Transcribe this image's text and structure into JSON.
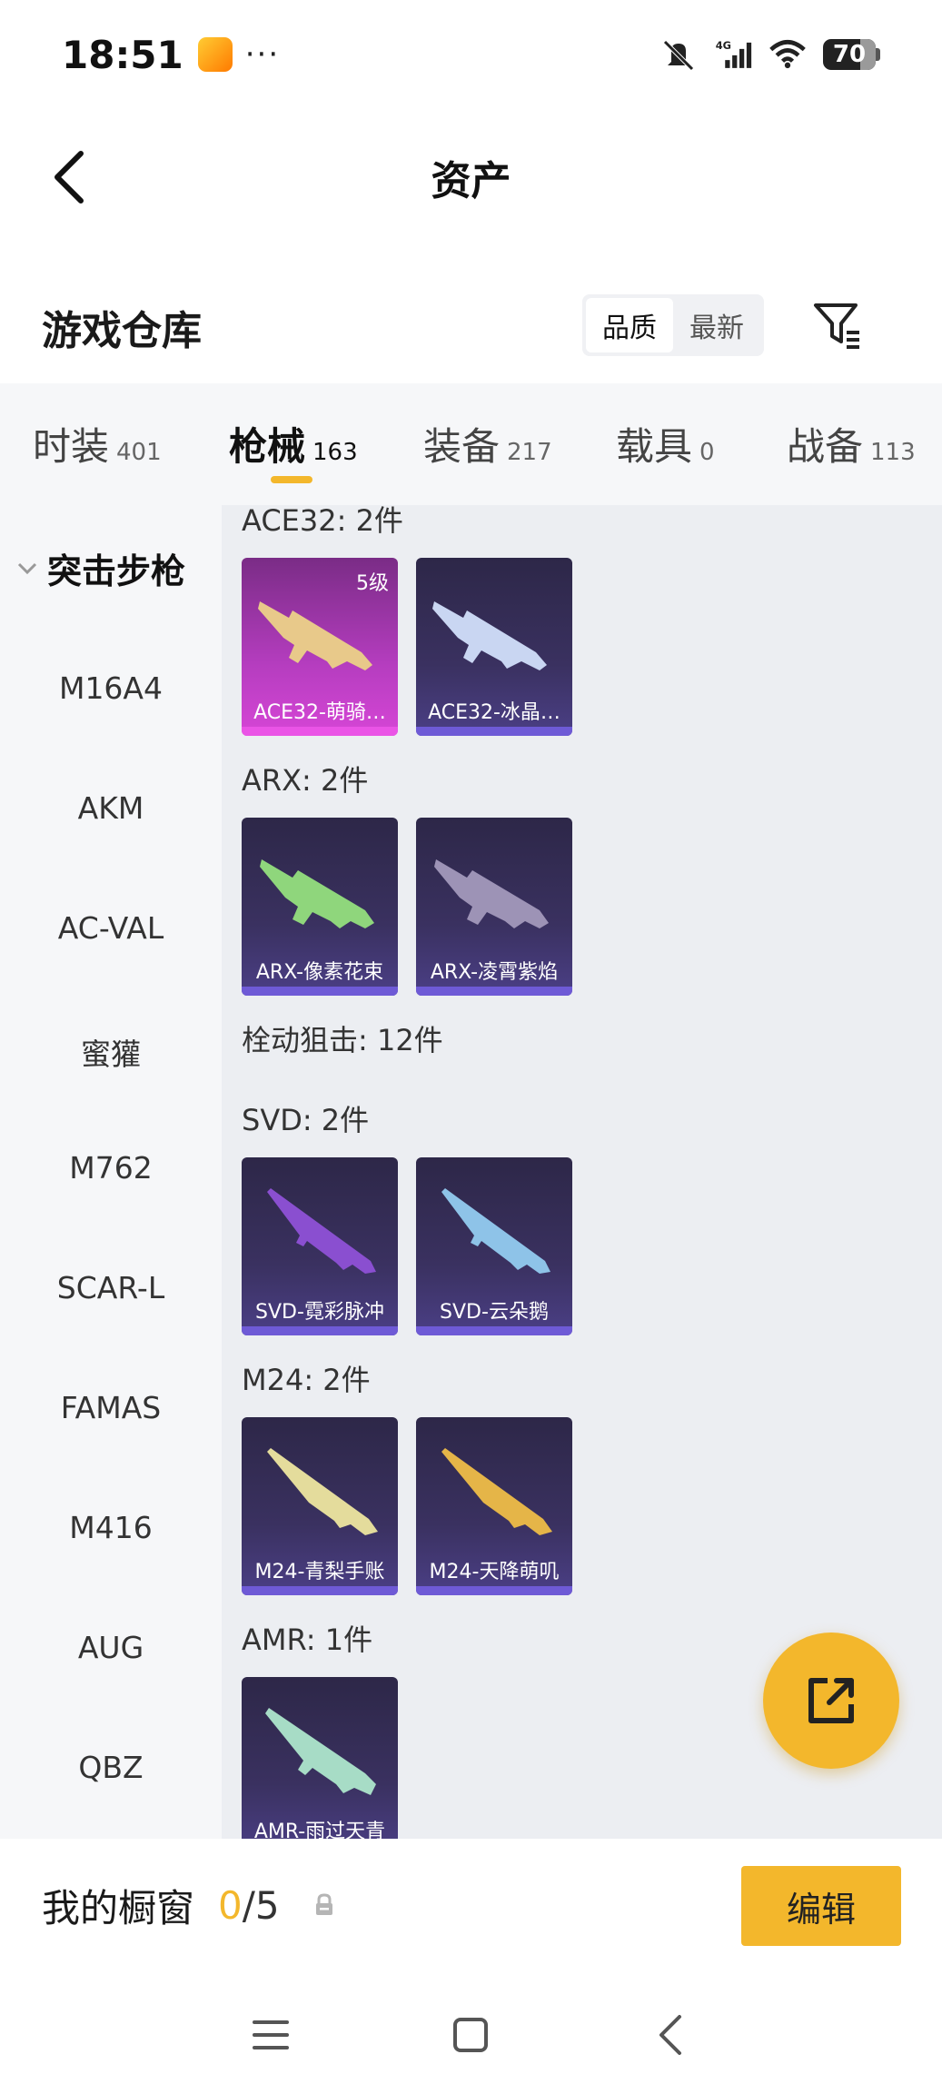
{
  "status_bar": {
    "time": "18:51",
    "more": "···",
    "network": "4G",
    "battery": "70"
  },
  "header": {
    "title": "资产"
  },
  "warehouse": {
    "title": "游戏仓库",
    "sort_options": [
      "品质",
      "最新"
    ]
  },
  "tabs": [
    {
      "label": "时装",
      "count": "401"
    },
    {
      "label": "枪械",
      "count": "163"
    },
    {
      "label": "装备",
      "count": "217"
    },
    {
      "label": "载具",
      "count": "0"
    },
    {
      "label": "战备",
      "count": "113"
    }
  ],
  "sidebar": {
    "group": "突击步枪",
    "items": [
      "M16A4",
      "AKM",
      "AC-VAL",
      "蜜獾",
      "M762",
      "SCAR-L",
      "FAMAS",
      "M416",
      "AUG",
      "QBZ"
    ]
  },
  "content": {
    "sections": [
      {
        "label": "ACE32: 2件"
      },
      {
        "label": "ARX: 2件"
      },
      {
        "label": "栓动狙击: 12件"
      },
      {
        "label": "SVD: 2件"
      },
      {
        "label": "M24: 2件"
      },
      {
        "label": "AMR: 1件"
      }
    ],
    "cards": [
      {
        "name": "ACE32-萌骑…",
        "grade": "5级",
        "rarity": "purple",
        "color": "#e8c98a"
      },
      {
        "name": "ACE32-冰晶…",
        "rarity": "dark",
        "color": "#c9d6f2"
      },
      {
        "name": "ARX-像素花束",
        "rarity": "dark",
        "color": "#8fd67c"
      },
      {
        "name": "ARX-凌霄紫焰",
        "rarity": "dark",
        "color": "#9d93b6"
      },
      {
        "name": "SVD-霓彩脉冲",
        "rarity": "dark",
        "color": "#8a4fd0"
      },
      {
        "name": "SVD-云朵鹅",
        "rarity": "dark",
        "color": "#8ec3e8"
      },
      {
        "name": "M24-青梨手账",
        "rarity": "dark",
        "color": "#e4dc9c"
      },
      {
        "name": "M24-天降萌叽",
        "rarity": "dark",
        "color": "#e5b548"
      },
      {
        "name": "AMR-雨过天青",
        "rarity": "dark",
        "color": "#a7dcc6"
      }
    ]
  },
  "showcase": {
    "title": "我的橱窗",
    "current": "0",
    "separator": "/",
    "total": "5",
    "edit_label": "编辑"
  },
  "colors": {
    "accent": "#f3b72c"
  }
}
